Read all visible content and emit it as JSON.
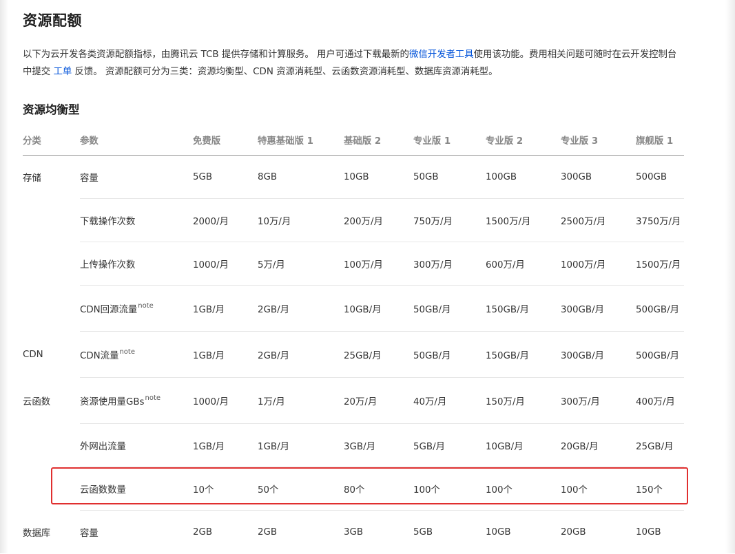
{
  "page": {
    "title": "资源配额",
    "intro": {
      "part1": "以下为云开发各类资源配额指标，由腾讯云 TCB 提供存储和计算服务。 用户可通过下载最新的",
      "link1": "微信开发者工具",
      "part2": "使用该功能。费用相关问题可随时在云开发控制台中提交 ",
      "link2": "工单",
      "part3": " 反馈。 资源配额可分为三类：资源均衡型、CDN 资源消耗型、云函数资源消耗型、数据库资源消耗型。"
    },
    "section_title": "资源均衡型"
  },
  "table": {
    "headers": [
      "分类",
      "参数",
      "免费版",
      "特惠基础版 1",
      "基础版 2",
      "专业版 1",
      "专业版 2",
      "专业版 3",
      "旗舰版 1"
    ],
    "rows": [
      {
        "category": "存储",
        "param": "容量",
        "note": "",
        "values": [
          "5GB",
          "8GB",
          "10GB",
          "50GB",
          "100GB",
          "300GB",
          "500GB"
        ]
      },
      {
        "category": "",
        "param": "下载操作次数",
        "note": "",
        "values": [
          "2000/月",
          "10万/月",
          "200万/月",
          "750万/月",
          "1500万/月",
          "2500万/月",
          "3750万/月"
        ]
      },
      {
        "category": "",
        "param": "上传操作次数",
        "note": "",
        "values": [
          "1000/月",
          "5万/月",
          "100万/月",
          "300万/月",
          "600万/月",
          "1000万/月",
          "1500万/月"
        ]
      },
      {
        "category": "",
        "param": "CDN回源流量",
        "note": "note",
        "values": [
          "1GB/月",
          "2GB/月",
          "10GB/月",
          "50GB/月",
          "150GB/月",
          "300GB/月",
          "500GB/月"
        ]
      },
      {
        "category": "CDN",
        "param": "CDN流量",
        "note": "note",
        "values": [
          "1GB/月",
          "2GB/月",
          "25GB/月",
          "50GB/月",
          "150GB/月",
          "300GB/月",
          "500GB/月"
        ]
      },
      {
        "category": "云函数",
        "param": "资源使用量GBs",
        "note": "note",
        "values": [
          "1000/月",
          "1万/月",
          "20万/月",
          "40万/月",
          "150万/月",
          "300万/月",
          "400万/月"
        ]
      },
      {
        "category": "",
        "param": "外网出流量",
        "note": "",
        "values": [
          "1GB/月",
          "1GB/月",
          "3GB/月",
          "5GB/月",
          "10GB/月",
          "20GB/月",
          "25GB/月"
        ]
      },
      {
        "category": "",
        "param": "云函数数量",
        "note": "",
        "values": [
          "10个",
          "50个",
          "80个",
          "100个",
          "100个",
          "100个",
          "150个"
        ]
      },
      {
        "category": "数据库",
        "param": "容量",
        "note": "",
        "values": [
          "2GB",
          "2GB",
          "3GB",
          "5GB",
          "10GB",
          "20GB",
          "10GB"
        ]
      }
    ]
  },
  "colors": {
    "link": "#0052d9",
    "highlight_border": "#e02f2f",
    "header_text": "#888888"
  }
}
